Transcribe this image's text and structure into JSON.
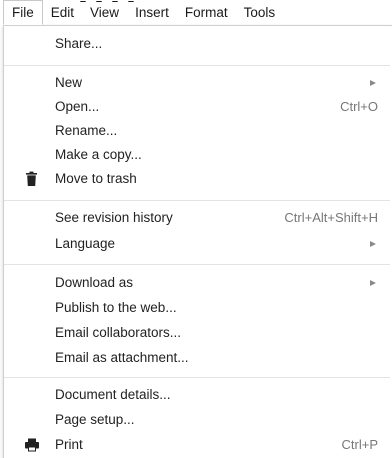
{
  "menubar": {
    "items": [
      {
        "label": "File",
        "active": true
      },
      {
        "label": "Edit"
      },
      {
        "label": "View"
      },
      {
        "label": "Insert"
      },
      {
        "label": "Format"
      },
      {
        "label": "Tools"
      }
    ]
  },
  "file_menu": {
    "items": [
      {
        "label": "Share..."
      },
      {
        "label": "New",
        "submenu": true
      },
      {
        "label": "Open...",
        "shortcut": "Ctrl+O"
      },
      {
        "label": "Rename..."
      },
      {
        "label": "Make a copy..."
      },
      {
        "label": "Move to trash",
        "icon": "trash-icon"
      },
      {
        "label": "See revision history",
        "shortcut": "Ctrl+Alt+Shift+H"
      },
      {
        "label": "Language",
        "submenu": true
      },
      {
        "label": "Download as",
        "submenu": true
      },
      {
        "label": "Publish to the web..."
      },
      {
        "label": "Email collaborators..."
      },
      {
        "label": "Email as attachment..."
      },
      {
        "label": "Document details..."
      },
      {
        "label": "Page setup..."
      },
      {
        "label": "Print",
        "shortcut": "Ctrl+P",
        "icon": "printer-icon"
      }
    ]
  },
  "colors": {
    "text": "#222222",
    "shortcut": "#777777",
    "separator": "#e3e3e3",
    "border": "#cfcfcf"
  }
}
